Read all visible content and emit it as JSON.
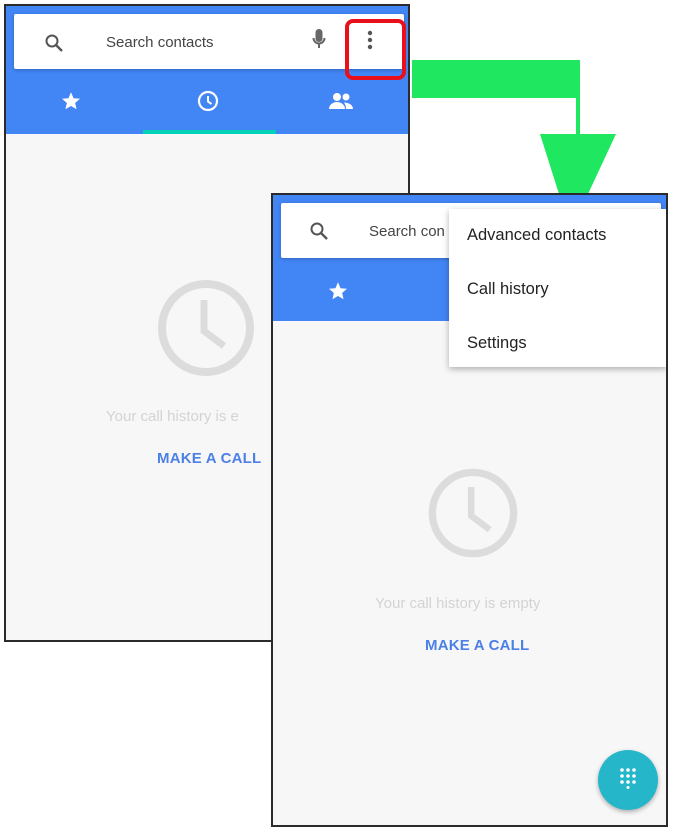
{
  "colors": {
    "appbar": "#4285f4",
    "tab_indicator": "#00d2b9",
    "arrow": "#1fe860",
    "highlight": "#e8101b",
    "fab": "#26b6c9",
    "link": "#4d80e6"
  },
  "screen1": {
    "search_placeholder": "Search contacts",
    "tabs": [
      {
        "icon": "star-icon"
      },
      {
        "icon": "clock-icon",
        "selected": true
      },
      {
        "icon": "people-icon"
      }
    ],
    "empty_text": "Your call history is e",
    "make_call": "MAKE A CALL"
  },
  "screen2": {
    "search_placeholder": "Search con",
    "menu": {
      "items": [
        "Advanced contacts",
        "Call history",
        "Settings"
      ]
    },
    "empty_text": "Your call history is empty",
    "make_call": "MAKE A CALL",
    "fab_icon": "dialpad-icon"
  }
}
